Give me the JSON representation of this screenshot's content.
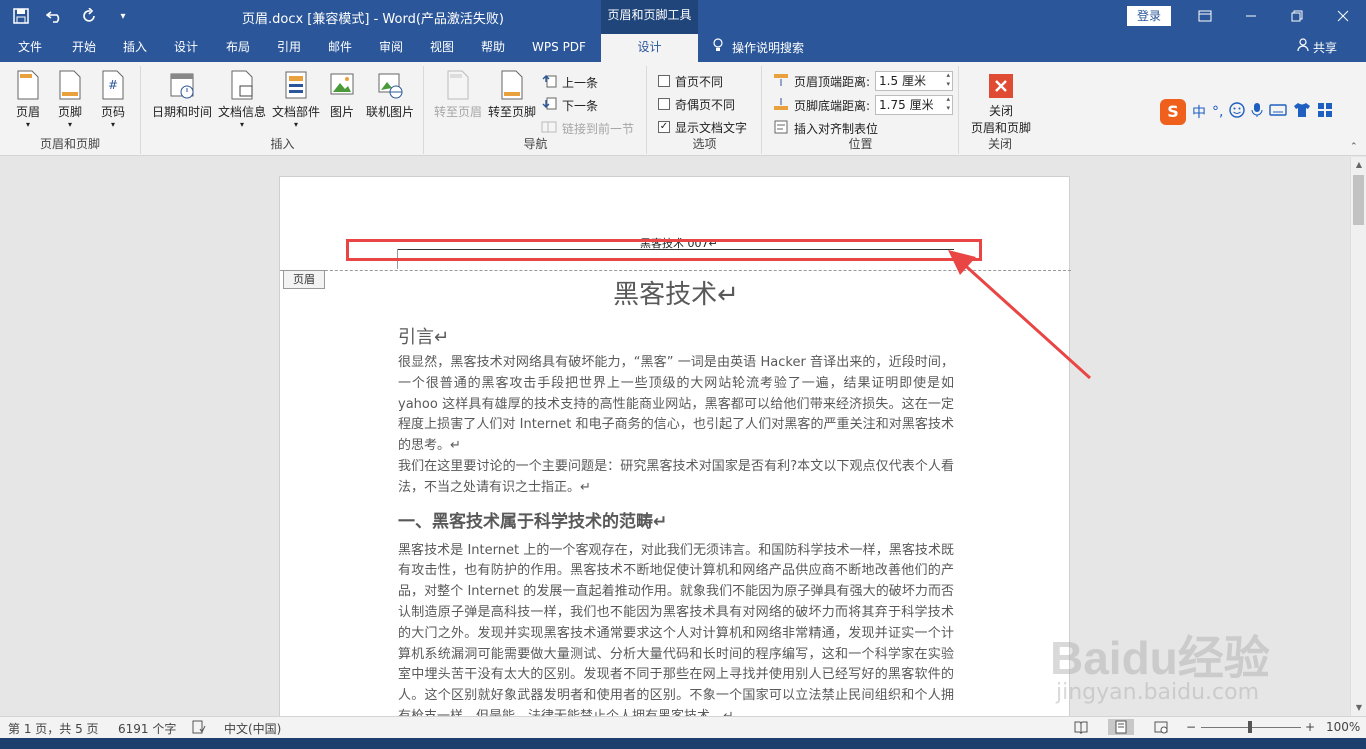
{
  "titlebar": {
    "title": "页眉.docx [兼容模式]  -  Word(产品激活失败)",
    "context_tab": "页眉和页脚工具",
    "login": "登录"
  },
  "tabs": [
    {
      "label": "文件"
    },
    {
      "label": "开始"
    },
    {
      "label": "插入"
    },
    {
      "label": "设计"
    },
    {
      "label": "布局"
    },
    {
      "label": "引用"
    },
    {
      "label": "邮件"
    },
    {
      "label": "审阅"
    },
    {
      "label": "视图"
    },
    {
      "label": "帮助"
    },
    {
      "label": "WPS PDF"
    },
    {
      "label": "设计"
    }
  ],
  "tell_me": "操作说明搜索",
  "share": "共享",
  "ribbon": {
    "groups": {
      "header_footer": "页眉和页脚",
      "insert": "插入",
      "navigation": "导航",
      "options": "选项",
      "position": "位置",
      "close": "关闭"
    },
    "buttons": {
      "header": "页眉",
      "footer": "页脚",
      "page_number": "页码",
      "date_time": "日期和时间",
      "doc_info": "文档信息",
      "doc_parts": "文档部件",
      "picture": "图片",
      "online_picture": "联机图片",
      "goto_header": "转至页眉",
      "goto_footer": "转至页脚",
      "previous": "上一条",
      "next": "下一条",
      "link_previous": "链接到前一节",
      "diff_first_page": "首页不同",
      "diff_odd_even": "奇偶页不同",
      "show_doc_text": "显示文档文字",
      "header_top_label": "页眉顶端距离:",
      "header_top_value": "1.5 厘米",
      "footer_bottom_label": "页脚底端距离:",
      "footer_bottom_value": "1.75 厘米",
      "insert_align_tab": "插入对齐制表位",
      "close_line1": "关闭",
      "close_line2": "页眉和页脚"
    }
  },
  "ime": {
    "logo": "S",
    "lang": "中",
    "punct": "°,"
  },
  "document": {
    "header_text": "黑客技术 007↵",
    "header_tag": "页眉",
    "title": "黑客技术↵",
    "intro_heading": "引言↵",
    "para1": "很显然，黑客技术对网络具有破坏能力，“黑客” 一词是由英语 Hacker 音译出来的，近段时间，一个很普通的黑客攻击手段把世界上一些顶级的大网站轮流考验了一遍，结果证明即使是如 yahoo 这样具有雄厚的技术支持的高性能商业网站，黑客都可以给他们带来经济损失。这在一定程度上损害了人们对 Internet 和电子商务的信心，也引起了人们对黑客的严重关注和对黑客技术的思考。↵",
    "para2": "我们在这里要讨论的一个主要问题是：研究黑客技术对国家是否有利?本文以下观点仅代表个人看法，不当之处请有识之士指正。↵",
    "section1_heading": "一、黑客技术属于科学技术的范畴↵",
    "para3": "黑客技术是 Internet 上的一个客观存在，对此我们无须讳言。和国防科学技术一样，黑客技术既有攻击性，也有防护的作用。黑客技术不断地促使计算机和网络产品供应商不断地改善他们的产品，对整个 Internet 的发展一直起着推动作用。就象我们不能因为原子弹具有强大的破坏力而否认制造原子弹是高科技一样，我们也不能因为黑客技术具有对网络的破坏力而将其弃于科学技术的大门之外。发现并实现黑客技术通常要求这个人对计算机和网络非常精通，发现并证实一个计算机系统漏洞可能需要做大量测试、分析大量代码和长时间的程序编写，这和一个科学家在实验室中埋头苦干没有太大的区别。发现者不同于那些在网上寻找并使用别人已经写好的黑客软件的人。这个区别就好象武器发明者和使用者的区别。不象一个国家可以立法禁止民间组织和个人拥有枪支一样，但是能，法律无能禁止个人拥有黑客技术。↵"
  },
  "status": {
    "page": "第 1 页，共 5 页",
    "words": "6191 个字",
    "lang": "中文(中国)",
    "zoom": "100%",
    "zoom_minus": "−",
    "zoom_plus": "+"
  },
  "watermark": {
    "brand": "Baidu经验",
    "url": "jingyan.baidu.com"
  },
  "colors": {
    "titlebar": "#2b579a",
    "highlight": "#e94545"
  }
}
